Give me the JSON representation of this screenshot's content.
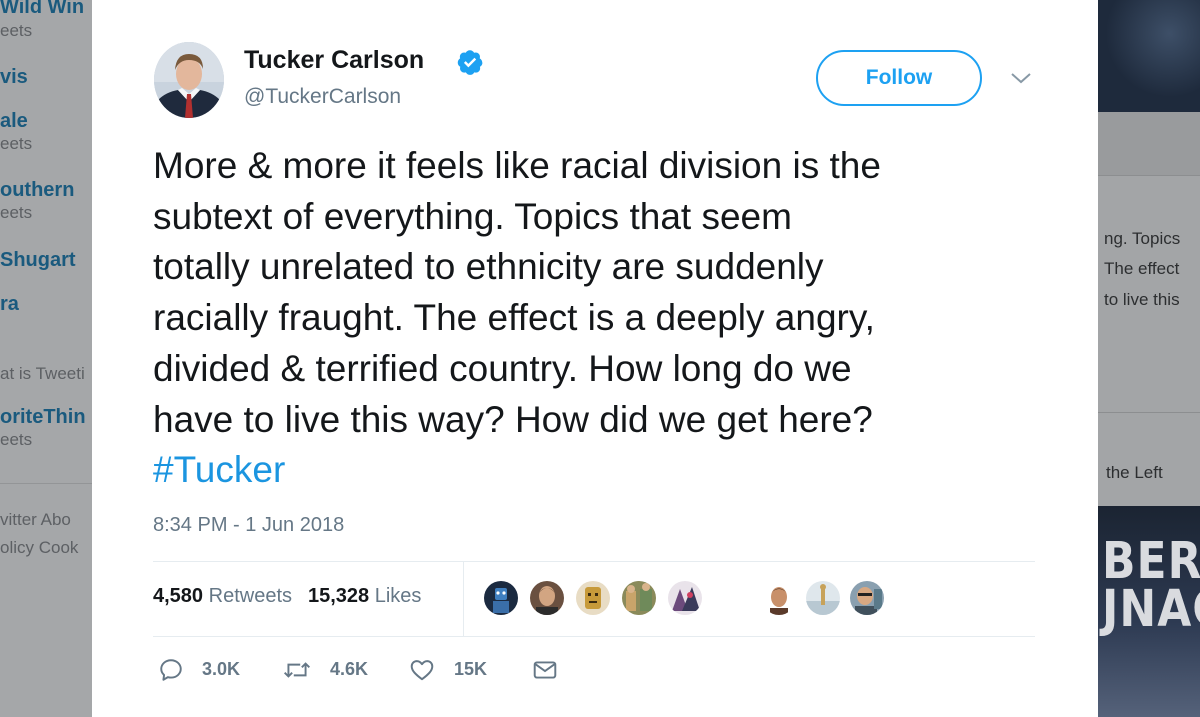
{
  "background_left": {
    "trends": [
      {
        "title": "Wild Win",
        "count": "eets"
      },
      {
        "title": "vis",
        "count": ""
      },
      {
        "title": "ale",
        "count": "eets"
      },
      {
        "title": "outhern",
        "count": "eets"
      },
      {
        "title": "Shugart",
        "count": ""
      },
      {
        "title": "ra",
        "count": ""
      },
      {
        "title": "",
        "count": "at is Tweeti"
      },
      {
        "title": "oriteThin",
        "count": "eets"
      }
    ],
    "footer": [
      "vitter  Abo",
      "olicy  Cook"
    ]
  },
  "background_right": {
    "snippet_lines": [
      "ng. Topics",
      "The effect",
      "to live this"
    ],
    "snippet2": "the Left",
    "banner_lines": [
      "BERA",
      "JNAC"
    ]
  },
  "tweet": {
    "author_name": "Tucker Carlson",
    "handle": "@TuckerCarlson",
    "follow_label": "Follow",
    "text_lines": [
      "More & more it feels like racial division is the",
      "subtext of everything. Topics that seem",
      "totally unrelated to ethnicity are suddenly",
      "racially fraught. The effect is a deeply angry,",
      "divided & terrified country. How long do we",
      "have to live this way? How did we get here?"
    ],
    "hashtag": "#Tucker",
    "timestamp": "8:34 PM - 1 Jun 2018",
    "retweets_count": "4,580",
    "retweets_label": "Retweets",
    "likes_count": "15,328",
    "likes_label": "Likes",
    "actions": {
      "reply_count": "3.0K",
      "retweet_count": "4.6K",
      "like_count": "15K"
    }
  },
  "colors": {
    "brand_blue": "#1da1f2",
    "hashtag_blue": "#1b95e0",
    "text_primary": "#14171a",
    "text_secondary": "#657786"
  },
  "icons": [
    "verified-badge-icon",
    "chevron-down-icon",
    "reply-icon",
    "retweet-icon",
    "like-heart-icon",
    "direct-message-icon"
  ]
}
